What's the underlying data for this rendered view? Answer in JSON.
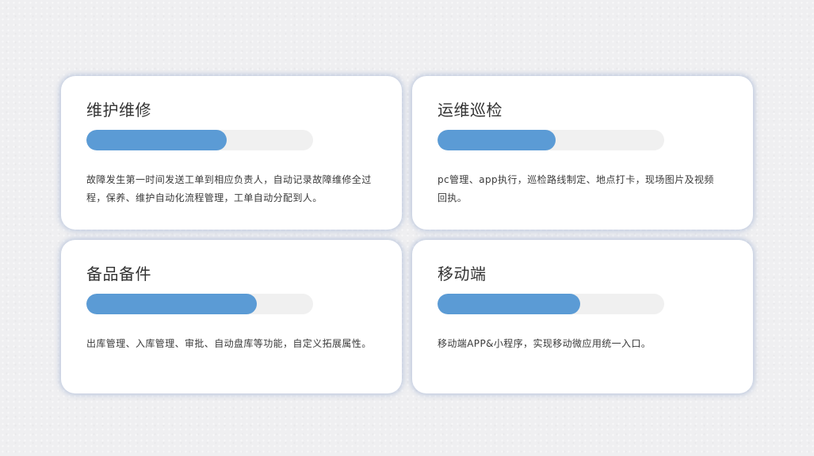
{
  "colors": {
    "background": "#efeff1",
    "card": "#ffffff",
    "progress_fill": "#5b9bd5",
    "progress_track": "#f0f0f0"
  },
  "cards": [
    {
      "title": "维护维修",
      "progress": 0.62,
      "description": "故障发生第一时间发送工单到相应负责人，自动记录故障维修全过程，保养、维护自动化流程管理，工单自动分配到人。"
    },
    {
      "title": "运维巡检",
      "progress": 0.52,
      "description": "pc管理、app执行，巡检路线制定、地点打卡，现场图片及视频回执。"
    },
    {
      "title": "备品备件",
      "progress": 0.75,
      "description": "出库管理、入库管理、审批、自动盘库等功能，自定义拓展属性。"
    },
    {
      "title": "移动端",
      "progress": 0.63,
      "description": "移动端APP&小程序，实现移动微应用统一入口。"
    }
  ]
}
